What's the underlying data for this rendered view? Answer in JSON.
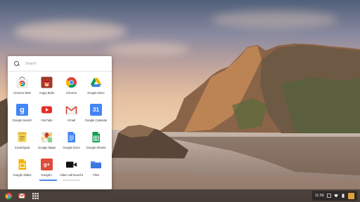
{
  "launcher": {
    "search_placeholder": "Search",
    "apps": [
      {
        "name": "Chrome Web Store",
        "label": "Chrome Web",
        "icon": "chrome-web-store-icon"
      },
      {
        "name": "Angry Birds",
        "label": "Angry Birds",
        "icon": "angry-birds-icon"
      },
      {
        "name": "Chrome",
        "label": "Chrome",
        "icon": "chrome-icon"
      },
      {
        "name": "Google Drive",
        "label": "Google Drive",
        "icon": "google-drive-icon"
      },
      {
        "name": "Google Search",
        "label": "Google Search",
        "icon": "google-search-icon"
      },
      {
        "name": "YouTube",
        "label": "YouTube",
        "icon": "youtube-icon"
      },
      {
        "name": "Gmail",
        "label": "Gmail",
        "icon": "gmail-icon"
      },
      {
        "name": "Google Calendar",
        "label": "Google Calendar",
        "icon": "google-calendar-icon"
      },
      {
        "name": "Scratchpad",
        "label": "Scratchpad",
        "icon": "scratchpad-icon"
      },
      {
        "name": "Google Maps",
        "label": "Google Maps",
        "icon": "google-maps-icon"
      },
      {
        "name": "Google Docs",
        "label": "Google Docs",
        "icon": "google-docs-icon"
      },
      {
        "name": "Google Sheets",
        "label": "Google Sheets",
        "icon": "google-sheets-icon"
      },
      {
        "name": "Google Slides",
        "label": "Google Slides",
        "icon": "google-slides-icon"
      },
      {
        "name": "Google+",
        "label": "Google+",
        "icon": "google-plus-icon"
      },
      {
        "name": "Video call launcher",
        "label": "Video call launcher",
        "icon": "video-call-icon"
      },
      {
        "name": "Files",
        "label": "Files",
        "icon": "files-icon"
      }
    ],
    "calendar_glyph": "31",
    "google_glyph": "g",
    "gplus_glyph": "g+",
    "gmail_glyph": "M",
    "pages": 2,
    "current_page": 1
  },
  "shelf": {
    "items": [
      "chrome-icon",
      "gmail-icon",
      "launcher-icon"
    ],
    "clock": "11:56",
    "tray_icons": [
      "notification-icon",
      "wifi-icon",
      "battery-icon",
      "avatar"
    ]
  },
  "colors": {
    "accent": "#4c8bf5",
    "youtube": "#e52d27",
    "gmail": "#d44638",
    "drive_green": "#0f9d58",
    "drive_yellow": "#f4b400",
    "google_blue": "#4285f4",
    "gplus": "#dd4b39",
    "sheets": "#0f9d58",
    "slides": "#f4b400",
    "docs": "#4285f4"
  }
}
